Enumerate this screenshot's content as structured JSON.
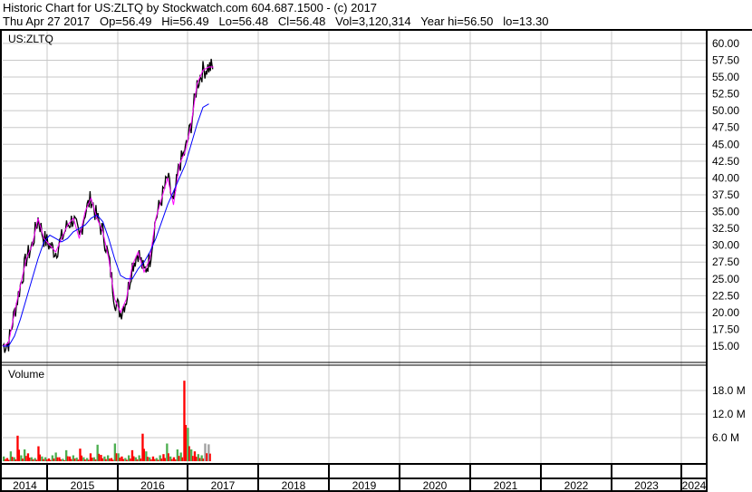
{
  "header": {
    "line1": "Historic Chart for US:ZLTQ by Stockwatch.com 604.687.1500 - (c) 2017",
    "line2": "Thu Apr 27 2017   Op=56.49   Hi=56.49   Lo=56.48   Cl=56.48   Vol=3,120,314   Year hi=56.50   lo=13.30"
  },
  "chart_data": [
    {
      "type": "line",
      "title": "US:ZLTQ",
      "ylim": [
        12.5,
        62.5
      ],
      "yticks": [
        "15.00",
        "17.50",
        "20.00",
        "22.50",
        "25.00",
        "27.50",
        "30.00",
        "32.50",
        "35.00",
        "37.50",
        "40.00",
        "42.50",
        "45.00",
        "47.50",
        "50.00",
        "52.50",
        "55.00",
        "57.50",
        "60.00"
      ],
      "xticks": [
        "2014",
        "2015",
        "2016",
        "2017",
        "2018",
        "2019",
        "2020",
        "2021",
        "2022",
        "2023",
        "2024"
      ],
      "x_months_from_2014_05": [
        0,
        1,
        2,
        3,
        4,
        5,
        6,
        7,
        8,
        9,
        10,
        11,
        12,
        13,
        14,
        15,
        16,
        17,
        18,
        19,
        20,
        21,
        22,
        23,
        24,
        25,
        26,
        27,
        28,
        29,
        30,
        31,
        32,
        33,
        34,
        35,
        35.8
      ],
      "close": [
        15,
        15.5,
        20,
        24,
        28,
        30,
        34,
        31,
        30,
        29,
        31,
        33,
        34,
        31,
        35,
        37,
        34,
        32,
        28,
        22,
        20,
        22,
        27,
        29,
        26,
        28,
        34,
        37,
        40,
        36,
        42,
        44,
        48,
        54,
        56,
        56.5,
        56.48
      ],
      "moving_average": [
        15,
        15,
        16.5,
        19,
        22,
        25,
        28,
        30.5,
        31.5,
        31,
        30.5,
        31,
        32,
        32.5,
        33,
        34,
        34.5,
        33.5,
        31,
        28,
        25.5,
        25,
        25,
        26.5,
        27.5,
        29,
        31,
        33.5,
        36,
        38,
        40,
        42,
        45,
        48,
        50.5,
        51
      ],
      "colors": {
        "price": "#000000",
        "ma": "#0000ff",
        "trend": "#ff00ff"
      }
    },
    {
      "type": "bar",
      "title": "Volume",
      "yticks": [
        "6.0 M",
        "12.0 M",
        "18.0 M"
      ],
      "ylim": [
        0,
        22
      ],
      "unit": "M",
      "values": [
        1.2,
        0.8,
        2.5,
        1,
        6.5,
        1.5,
        3,
        2,
        1,
        0.8,
        3.8,
        1.2,
        1,
        0.7,
        1.5,
        2.2,
        1,
        0.6,
        2.8,
        1.2,
        1.5,
        0.9,
        3.2,
        1,
        0.8,
        2,
        1,
        4.2,
        1.6,
        1.2,
        1.5,
        0.8,
        4.5,
        2,
        1.2,
        0.8,
        1.5,
        2.8,
        1,
        1.5,
        7,
        2.5,
        1,
        1.2,
        0.8,
        1.5,
        1.8,
        4.5,
        1.2,
        1,
        3,
        2.2,
        20.5,
        8.5,
        3,
        2.5,
        1.8,
        1.5,
        4.5,
        4.3
      ],
      "colors": {
        "up": "#4caf50",
        "down": "#ff0000",
        "partial": "#a0a0a0"
      }
    }
  ]
}
